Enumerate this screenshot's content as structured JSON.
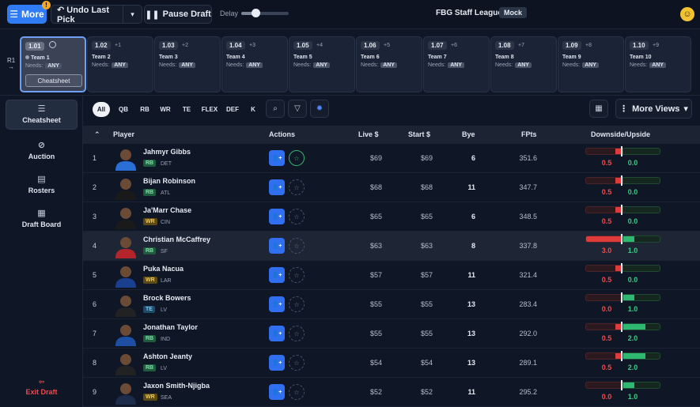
{
  "topbar": {
    "more_label": "More",
    "more_badge": "!",
    "undo_label": "Undo Last Pick",
    "pause_label": "Pause Draft",
    "delay_label": "Delay",
    "delay_level": 0.3,
    "league_name": "FBG Staff League",
    "mode_badge": "Mock"
  },
  "strip": {
    "round_label": "R1",
    "round_arrow": "→",
    "needs_label": "Needs:",
    "needs_value": "ANY",
    "cheatsheet_label": "Cheatsheet",
    "picks": [
      {
        "no": "1.01",
        "after": "",
        "team": "Team 1",
        "active": true
      },
      {
        "no": "1.02",
        "after": "+1",
        "team": "Team 2"
      },
      {
        "no": "1.03",
        "after": "+2",
        "team": "Team 3"
      },
      {
        "no": "1.04",
        "after": "+3",
        "team": "Team 4"
      },
      {
        "no": "1.05",
        "after": "+4",
        "team": "Team 5"
      },
      {
        "no": "1.06",
        "after": "+5",
        "team": "Team 6"
      },
      {
        "no": "1.07",
        "after": "+6",
        "team": "Team 7"
      },
      {
        "no": "1.08",
        "after": "+7",
        "team": "Team 8"
      },
      {
        "no": "1.09",
        "after": "+8",
        "team": "Team 9"
      },
      {
        "no": "1.10",
        "after": "+9",
        "team": "Team 10"
      }
    ]
  },
  "sidebar": {
    "items": [
      {
        "label": "Cheatsheet",
        "icon": "list-icon",
        "glyph": "☰"
      },
      {
        "label": "Auction",
        "icon": "check-circle-icon",
        "glyph": "⊘"
      },
      {
        "label": "Rosters",
        "icon": "clipboard-icon",
        "glyph": "▤"
      },
      {
        "label": "Draft Board",
        "icon": "board-icon",
        "glyph": "▦"
      }
    ],
    "exit_label": "Exit Draft",
    "exit_glyph": "⇦"
  },
  "filters": {
    "positions": [
      "All",
      "QB",
      "RB",
      "WR",
      "TE",
      "FLEX",
      "DEF",
      "K"
    ],
    "more_views_label": "More Views"
  },
  "table": {
    "headers": {
      "player": "Player",
      "actions": "Actions",
      "live": "Live $",
      "start": "Start $",
      "bye": "Bye",
      "fpts": "FPts",
      "range": "Downside/Upside"
    },
    "rows": [
      {
        "rank": "1",
        "name": "Jahmyr Gibbs",
        "pos": "RB",
        "team": "DET",
        "live": "$69",
        "start": "$69",
        "bye": "6",
        "fpts": "351.6",
        "down": "0.5",
        "up": "0.0",
        "starred": true,
        "jersey": "#2a6fd6"
      },
      {
        "rank": "2",
        "name": "Bijan Robinson",
        "pos": "RB",
        "team": "ATL",
        "live": "$68",
        "start": "$68",
        "bye": "11",
        "fpts": "347.7",
        "down": "0.5",
        "up": "0.0",
        "starred": false,
        "jersey": "#1a1a1a"
      },
      {
        "rank": "3",
        "name": "Ja'Marr Chase",
        "pos": "WR",
        "team": "CIN",
        "live": "$65",
        "start": "$65",
        "bye": "6",
        "fpts": "348.5",
        "down": "0.5",
        "up": "0.0",
        "starred": false,
        "jersey": "#1a1a1a"
      },
      {
        "rank": "4",
        "name": "Christian McCaffrey",
        "pos": "RB",
        "team": "SF",
        "live": "$63",
        "start": "$63",
        "bye": "8",
        "fpts": "337.8",
        "down": "3.0",
        "up": "1.0",
        "starred": false,
        "jersey": "#b3242b"
      },
      {
        "rank": "5",
        "name": "Puka Nacua",
        "pos": "WR",
        "team": "LAR",
        "live": "$57",
        "start": "$57",
        "bye": "11",
        "fpts": "321.4",
        "down": "0.5",
        "up": "0.0",
        "starred": false,
        "jersey": "#1b3f8f"
      },
      {
        "rank": "6",
        "name": "Brock Bowers",
        "pos": "TE",
        "team": "LV",
        "live": "$55",
        "start": "$55",
        "bye": "13",
        "fpts": "283.4",
        "down": "0.0",
        "up": "1.0",
        "starred": false,
        "jersey": "#222222"
      },
      {
        "rank": "7",
        "name": "Jonathan Taylor",
        "pos": "RB",
        "team": "IND",
        "live": "$55",
        "start": "$55",
        "bye": "13",
        "fpts": "292.0",
        "down": "0.5",
        "up": "2.0",
        "starred": false,
        "jersey": "#1d4fa5"
      },
      {
        "rank": "8",
        "name": "Ashton Jeanty",
        "pos": "RB",
        "team": "LV",
        "live": "$54",
        "start": "$54",
        "bye": "13",
        "fpts": "289.1",
        "down": "0.5",
        "up": "2.0",
        "starred": false,
        "jersey": "#222222"
      },
      {
        "rank": "9",
        "name": "Jaxon Smith-Njigba",
        "pos": "WR",
        "team": "SEA",
        "live": "$52",
        "start": "$52",
        "bye": "11",
        "fpts": "295.2",
        "down": "0.0",
        "up": "1.0",
        "starred": false,
        "jersey": "#1c2c4a"
      }
    ]
  },
  "colors": {
    "accent": "#2f7cf6",
    "downside": "#e03b3b",
    "upside": "#2fb872",
    "background": "#0f1626"
  }
}
